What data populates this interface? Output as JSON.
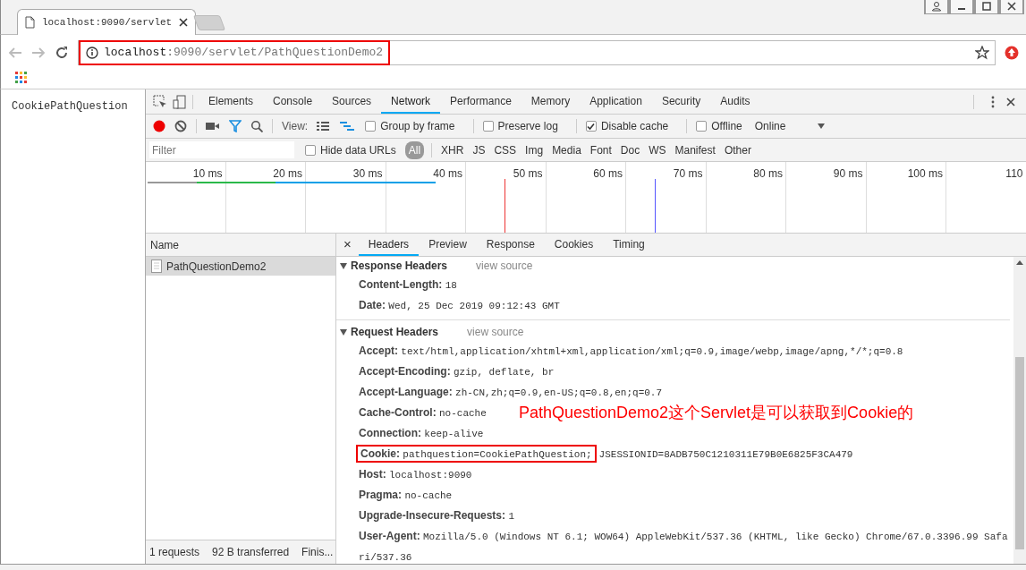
{
  "browser": {
    "tab_title": "localhost:9090/servlet",
    "address": {
      "host": "localhost",
      "path": ":9090/servlet/PathQuestionDemo2",
      "highlighted": true
    }
  },
  "page": {
    "text": "CookiePathQuestion"
  },
  "devtools": {
    "tabs": [
      {
        "label": "Elements",
        "selected": false
      },
      {
        "label": "Console",
        "selected": false
      },
      {
        "label": "Sources",
        "selected": false
      },
      {
        "label": "Network",
        "selected": true
      },
      {
        "label": "Performance",
        "selected": false
      },
      {
        "label": "Memory",
        "selected": false
      },
      {
        "label": "Application",
        "selected": false
      },
      {
        "label": "Security",
        "selected": false
      },
      {
        "label": "Audits",
        "selected": false
      }
    ],
    "toolbar": {
      "recording": true,
      "view_label": "View:",
      "options": [
        {
          "label": "Group by frame",
          "checked": false
        },
        {
          "label": "Preserve log",
          "checked": false
        },
        {
          "label": "Disable cache",
          "checked": true
        },
        {
          "label": "Offline",
          "checked": false
        }
      ],
      "throttling": "Online"
    },
    "filter": {
      "placeholder": "Filter",
      "hide_data_urls": {
        "label": "Hide data URLs",
        "checked": false
      },
      "types": [
        {
          "label": "All",
          "selected": true
        },
        {
          "label": "XHR",
          "selected": false
        },
        {
          "label": "JS",
          "selected": false
        },
        {
          "label": "CSS",
          "selected": false
        },
        {
          "label": "Img",
          "selected": false
        },
        {
          "label": "Media",
          "selected": false
        },
        {
          "label": "Font",
          "selected": false
        },
        {
          "label": "Doc",
          "selected": false
        },
        {
          "label": "WS",
          "selected": false
        },
        {
          "label": "Manifest",
          "selected": false
        },
        {
          "label": "Other",
          "selected": false
        }
      ]
    },
    "timeline": {
      "ticks": [
        "10 ms",
        "20 ms",
        "30 ms",
        "40 ms",
        "50 ms",
        "60 ms",
        "70 ms",
        "80 ms",
        "90 ms",
        "100 ms",
        "110"
      ]
    },
    "requests": {
      "column": "Name",
      "rows": [
        {
          "name": "PathQuestionDemo2",
          "selected": true
        }
      ],
      "status": [
        "1 requests",
        "92 B transferred",
        "Finis..."
      ]
    },
    "detail": {
      "close": "×",
      "tabs": [
        {
          "label": "Headers",
          "selected": true
        },
        {
          "label": "Preview",
          "selected": false
        },
        {
          "label": "Response",
          "selected": false
        },
        {
          "label": "Cookies",
          "selected": false
        },
        {
          "label": "Timing",
          "selected": false
        }
      ],
      "sections": [
        {
          "title": "Response Headers",
          "link": "view source",
          "expanded": true,
          "headers": [
            {
              "name": "Content-Length:",
              "value": "18"
            },
            {
              "name": "Date:",
              "value": "Wed, 25 Dec 2019 09:12:43 GMT"
            }
          ]
        },
        {
          "title": "Request Headers",
          "link": "view source",
          "expanded": true,
          "headers": [
            {
              "name": "Accept:",
              "value": "text/html,application/xhtml+xml,application/xml;q=0.9,image/webp,image/apng,*/*;q=0.8"
            },
            {
              "name": "Accept-Encoding:",
              "value": "gzip, deflate, br"
            },
            {
              "name": "Accept-Language:",
              "value": "zh-CN,zh;q=0.9,en-US;q=0.8,en;q=0.7"
            },
            {
              "name": "Cache-Control:",
              "value": "no-cache"
            },
            {
              "name": "Connection:",
              "value": "keep-alive"
            },
            {
              "name": "Cookie:",
              "value": "pathquestion=CookiePathQuestion;",
              "extra": "JSESSIONID=8ADB750C1210311E79B0E6825F3CA479",
              "highlighted": true
            },
            {
              "name": "Host:",
              "value": "localhost:9090"
            },
            {
              "name": "Pragma:",
              "value": "no-cache"
            },
            {
              "name": "Upgrade-Insecure-Requests:",
              "value": "1"
            },
            {
              "name": "User-Agent:",
              "value": "Mozilla/5.0 (Windows NT 6.1; WOW64) AppleWebKit/537.36 (KHTML, like Gecko) Chrome/67.0.3396.99 Safari/537.36"
            }
          ]
        }
      ]
    },
    "annotation": "PathQuestionDemo2这个Servlet是可以获取到Cookie的"
  }
}
